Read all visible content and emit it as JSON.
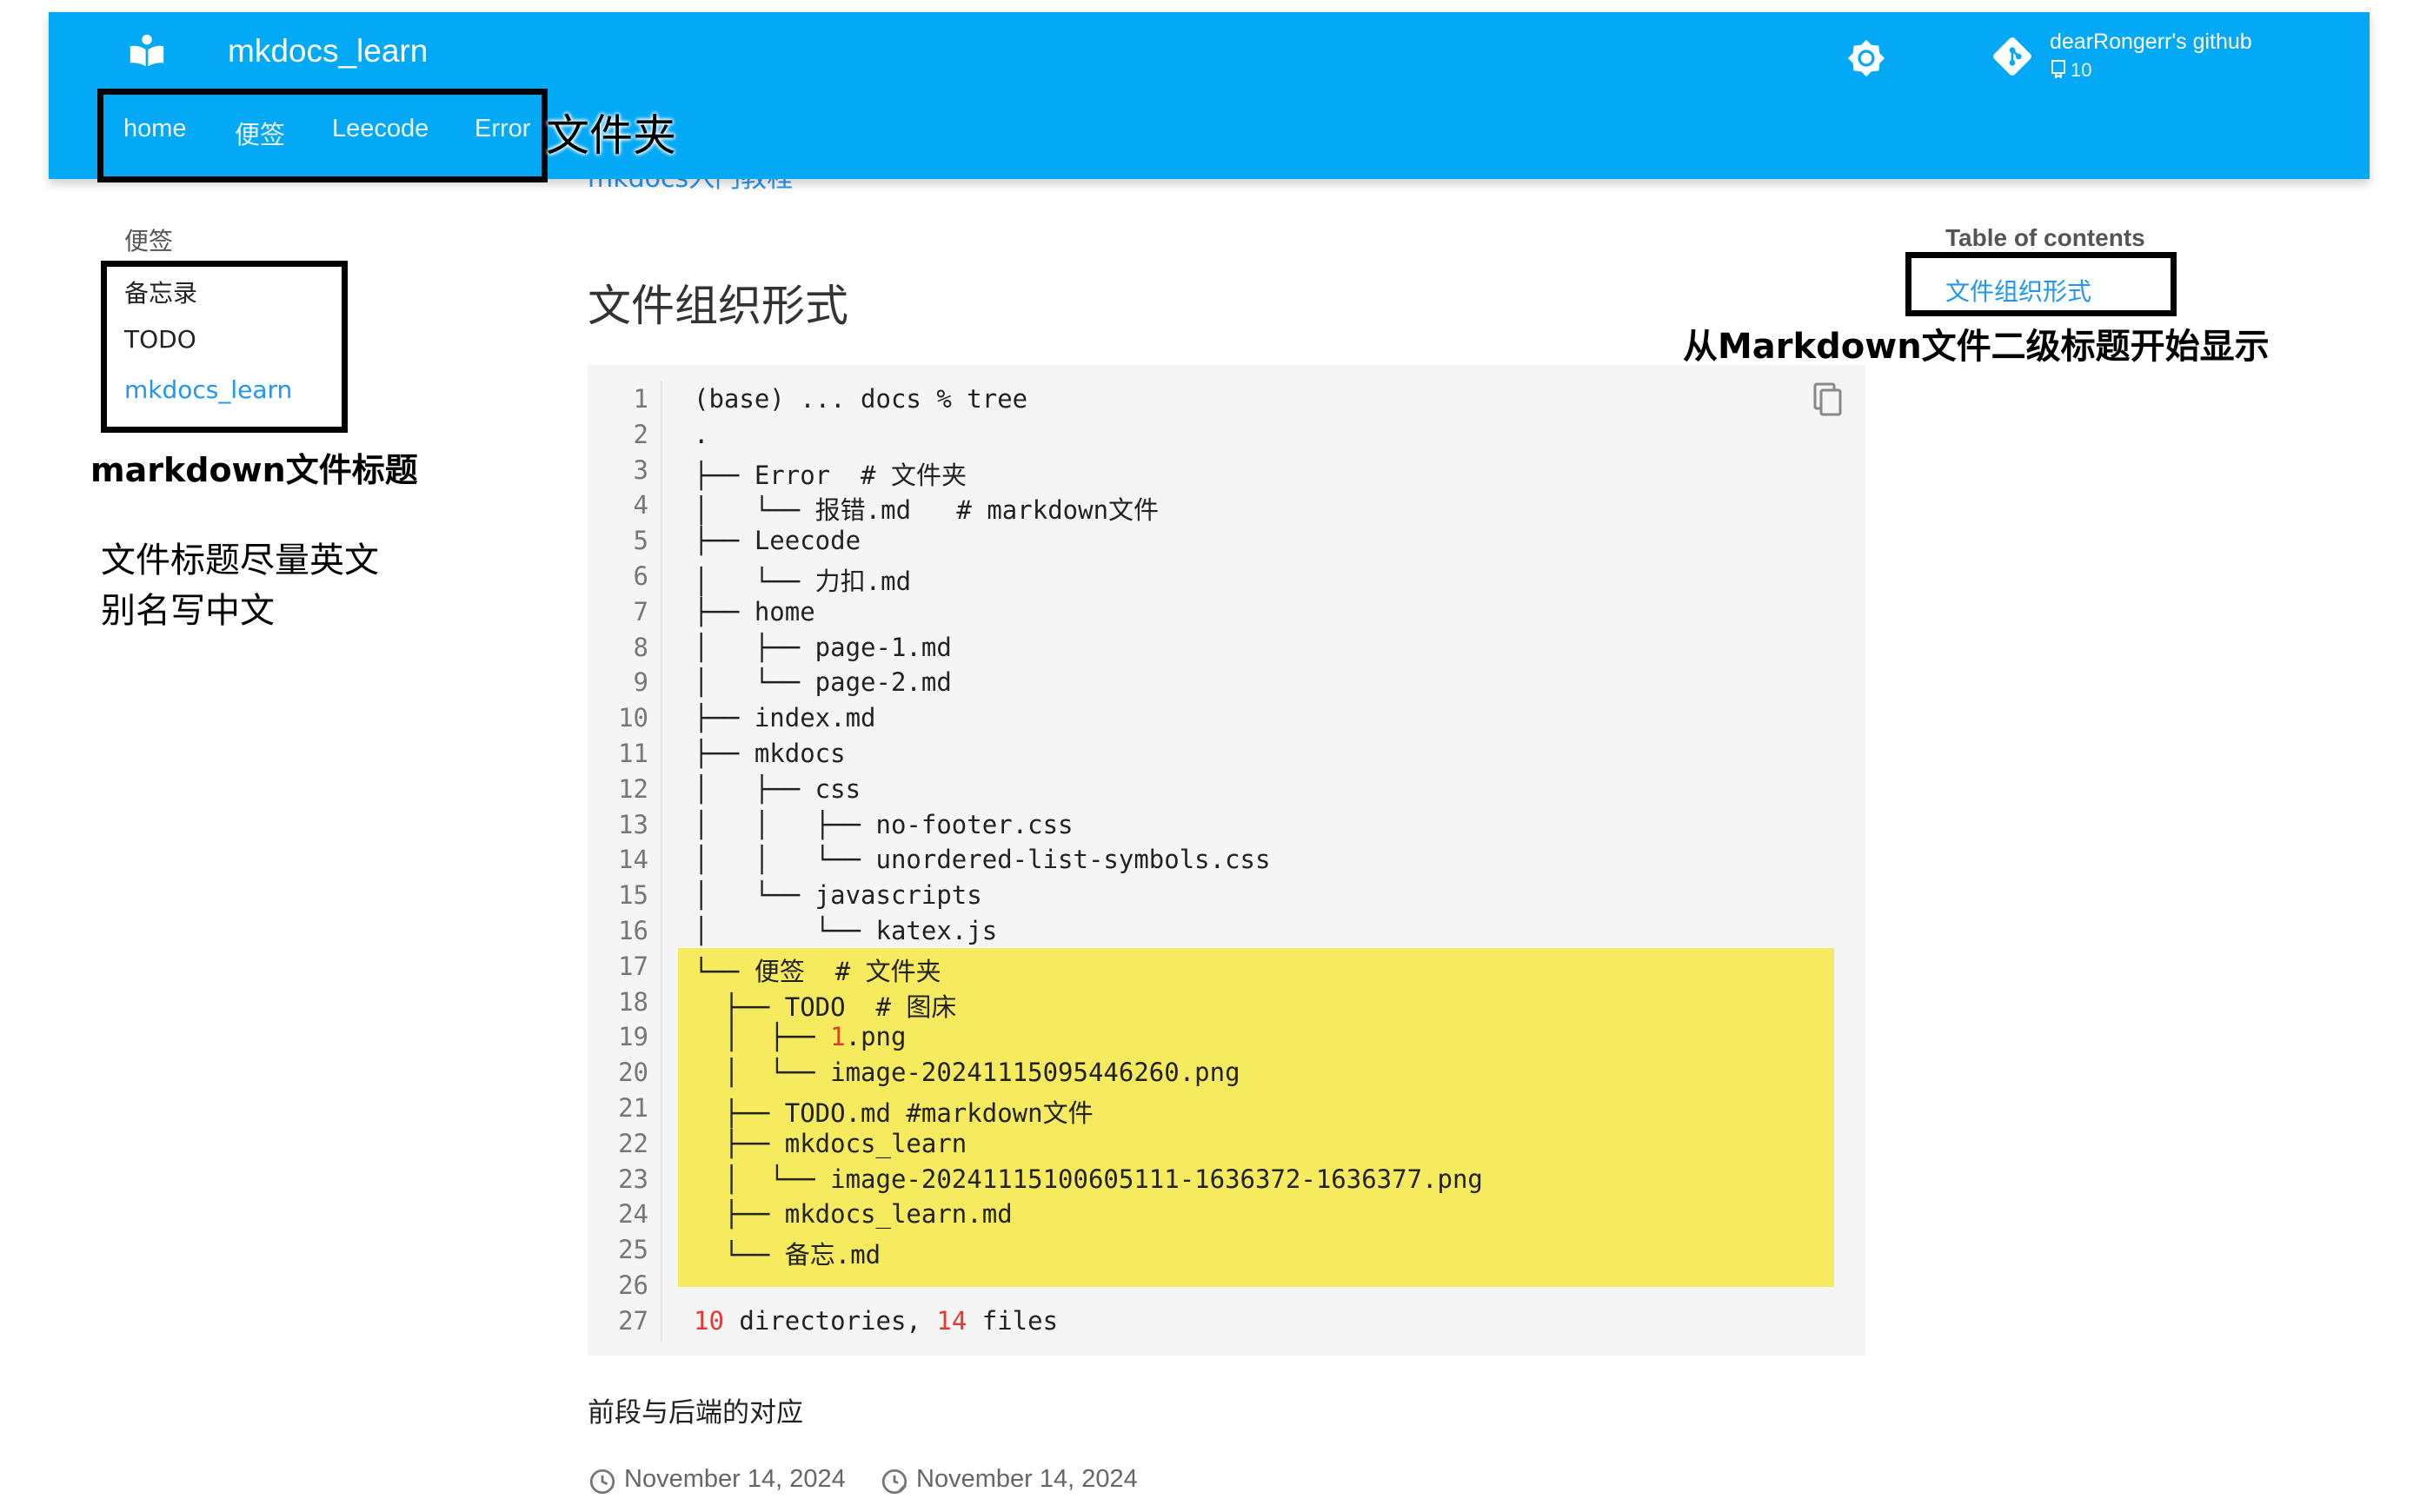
{
  "header": {
    "site_title": "mkdocs_learn",
    "tabs": [
      {
        "label": "home"
      },
      {
        "label": "便签"
      },
      {
        "label": "Leecode"
      },
      {
        "label": "Error"
      }
    ],
    "repo": {
      "name": "dearRongerr's github",
      "stat": "10"
    },
    "icons": [
      "book-open-icon",
      "brightness-icon",
      "git-icon",
      "repo-fork-icon"
    ],
    "color": "#03a9f4",
    "under_header_partial": "mkdocs入门教程"
  },
  "sidebar": {
    "title": "便签",
    "items": [
      {
        "label": "备忘录"
      },
      {
        "label": "TODO"
      },
      {
        "label": "mkdocs_learn"
      }
    ],
    "active_color": "#2196f3"
  },
  "toc": {
    "title": "Table of contents",
    "items": [
      {
        "label": "文件组织形式"
      }
    ]
  },
  "main": {
    "heading": "文件组织形式",
    "code_lines": [
      "(base) ... docs % tree",
      ".",
      "├── Error  # 文件夹",
      "│   └── 报错.md   # markdown文件",
      "├── Leecode",
      "│   └── 力扣.md",
      "├── home",
      "│   ├── page-1.md",
      "│   └── page-2.md",
      "├── index.md",
      "├── mkdocs",
      "│   ├── css",
      "│   │   ├── no-footer.css",
      "│   │   └── unordered-list-symbols.css",
      "│   └── javascripts",
      "│       └── katex.js",
      "└── 便签  # 文件夹",
      "  ├── TODO  # 图床",
      "  │  ├── 1.png",
      "  │  └── image-20241115095446260.png",
      "  ├── TODO.md #markdown文件",
      "  ├── mkdocs_learn",
      "  │  └── image-20241115100605111-1636372-1636377.png",
      "  ├── mkdocs_learn.md",
      "  └── 备忘.md",
      "",
      "10 directories, 14 files"
    ],
    "highlight_color": "#f6ea5e",
    "footer_text": "前段与后端的对应",
    "dates": {
      "created": "November 14, 2024",
      "updated": "November 14, 2024"
    }
  },
  "annotations": {
    "tabs_note": "文件夹",
    "sidebar_note": "markdown文件标题",
    "naming_note_line1": "文件标题尽量英文",
    "naming_note_line2": "别名写中文",
    "toc_note": "从Markdown文件二级标题开始显示"
  }
}
